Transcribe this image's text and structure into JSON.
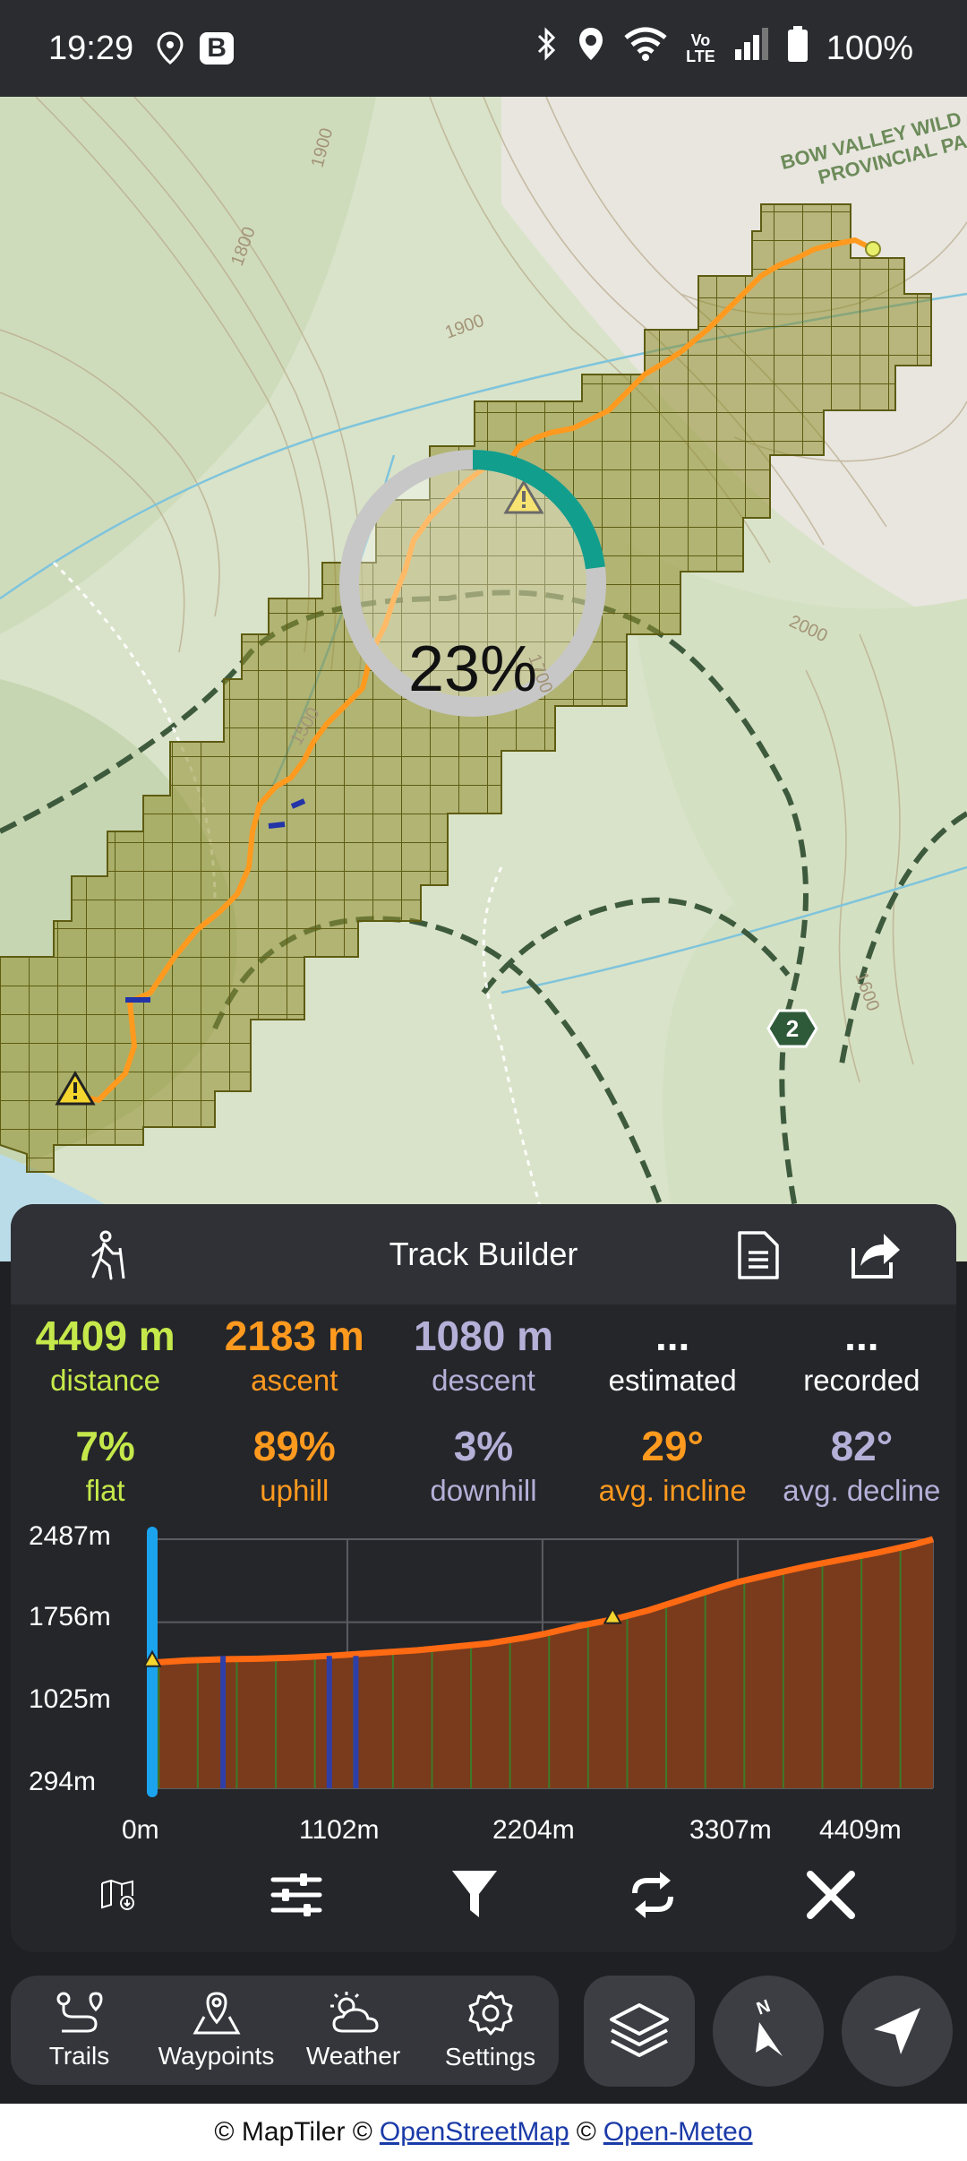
{
  "status_bar": {
    "time": "19:29",
    "badge": "B",
    "volte_top": "Vo",
    "volte_bottom": "LTE",
    "battery": "100%",
    "icons": [
      "location-pin-icon",
      "bluetooth-icon",
      "location-icon",
      "wifi-icon",
      "signal-icon",
      "battery-icon"
    ]
  },
  "map": {
    "area_label_line1": "BOW VALLEY WILD",
    "area_label_line2": "PROVINCIAL PA",
    "contours": [
      "1900",
      "1800",
      "1900",
      "2000",
      "1700",
      "1600",
      "1500"
    ],
    "route_marker": "2",
    "download_progress": "23%",
    "download_progress_fraction": 0.23,
    "colors": {
      "track": "#ff9a1f",
      "grid": "#8a8a2a",
      "progress": "#129e8c"
    }
  },
  "track_builder": {
    "title": "Track Builder",
    "stats_row1": [
      {
        "value": "4409 m",
        "label": "distance",
        "color": "#c5e84a"
      },
      {
        "value": "2183 m",
        "label": "ascent",
        "color": "#ff9a1f"
      },
      {
        "value": "1080 m",
        "label": "descent",
        "color": "#b4b0d8"
      },
      {
        "value": "...",
        "label": "estimated",
        "color": "#ffffff"
      },
      {
        "value": "...",
        "label": "recorded",
        "color": "#ffffff"
      }
    ],
    "stats_row2": [
      {
        "value": "7%",
        "label": "flat",
        "color": "#c5e84a"
      },
      {
        "value": "89%",
        "label": "uphill",
        "color": "#ff9a1f"
      },
      {
        "value": "3%",
        "label": "downhill",
        "color": "#b4b0d8"
      },
      {
        "value": "29°",
        "label": "avg. incline",
        "color": "#ff9a1f"
      },
      {
        "value": "82°",
        "label": "avg. decline",
        "color": "#b4b0d8"
      }
    ]
  },
  "chart_data": {
    "type": "area",
    "x": [
      0,
      200,
      400,
      600,
      800,
      1000,
      1102,
      1300,
      1500,
      1700,
      1900,
      2100,
      2204,
      2400,
      2600,
      2800,
      3000,
      3200,
      3307,
      3500,
      3700,
      3900,
      4100,
      4300,
      4409
    ],
    "y": [
      1400,
      1420,
      1430,
      1435,
      1445,
      1460,
      1470,
      1490,
      1510,
      1540,
      1570,
      1620,
      1650,
      1720,
      1780,
      1860,
      1960,
      2060,
      2110,
      2180,
      2250,
      2310,
      2370,
      2440,
      2487
    ],
    "ylabel_ticks": [
      "2487m",
      "1756m",
      "1025m",
      "294m"
    ],
    "y_ticks": [
      2487,
      1756,
      1025,
      294
    ],
    "xlabel_ticks": [
      "0m",
      "1102m",
      "2204m",
      "3307m",
      "4409m"
    ],
    "x_ticks": [
      0,
      1102,
      2204,
      3307,
      4409
    ],
    "xlim": [
      0,
      4409
    ],
    "ylim": [
      294,
      2487
    ],
    "grid": true,
    "warnings_at_x": [
      0,
      2600
    ],
    "colors": {
      "line": "#ff6a13",
      "fill": "#7a3b1c"
    }
  },
  "toolbar": {
    "icons": [
      "offline-map-icon",
      "sliders-icon",
      "filter-icon",
      "repeat-icon",
      "close-icon"
    ]
  },
  "bottom_nav": {
    "items": [
      {
        "label": "Trails",
        "icon": "trails-icon"
      },
      {
        "label": "Waypoints",
        "icon": "waypoint-icon"
      },
      {
        "label": "Weather",
        "icon": "weather-icon"
      },
      {
        "label": "Settings",
        "icon": "gear-icon"
      }
    ],
    "compass_letter": "N"
  },
  "attribution": {
    "prefix": "© MapTiler ©",
    "osm": "OpenStreetMap",
    "mid": "©",
    "meteo": "Open-Meteo"
  }
}
